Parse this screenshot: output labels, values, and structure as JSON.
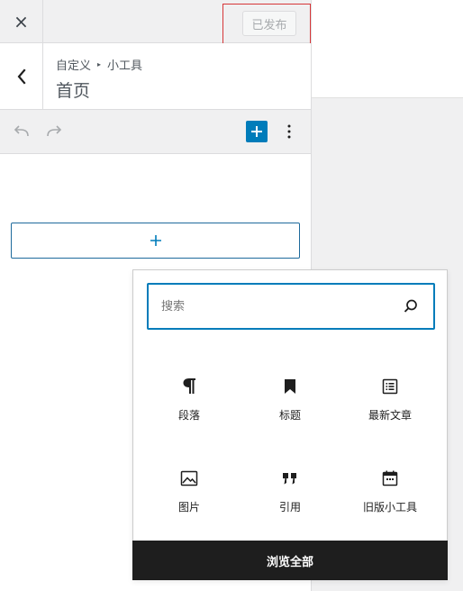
{
  "header": {
    "close_label": "×",
    "publish_label": "已发布"
  },
  "section": {
    "breadcrumb": [
      "自定义",
      "小工具"
    ],
    "breadcrumb_separator": "▸",
    "title": "首页"
  },
  "toolbar": {
    "undo_icon": "undo-icon",
    "redo_icon": "redo-icon",
    "add_icon": "plus-icon",
    "more_icon": "more-vertical-icon"
  },
  "appender": {
    "icon": "plus-icon"
  },
  "inserter": {
    "search_placeholder": "搜索",
    "blocks": [
      {
        "label": "段落",
        "icon": "paragraph-icon"
      },
      {
        "label": "标题",
        "icon": "bookmark-icon"
      },
      {
        "label": "最新文章",
        "icon": "list-icon"
      },
      {
        "label": "图片",
        "icon": "image-icon"
      },
      {
        "label": "引用",
        "icon": "quote-icon"
      },
      {
        "label": "旧版小工具",
        "icon": "calendar-icon"
      }
    ],
    "browse_all_label": "浏览全部"
  },
  "colors": {
    "accent": "#007cba",
    "highlight_border": "#d63638",
    "dark_button": "#1e1e1e"
  }
}
